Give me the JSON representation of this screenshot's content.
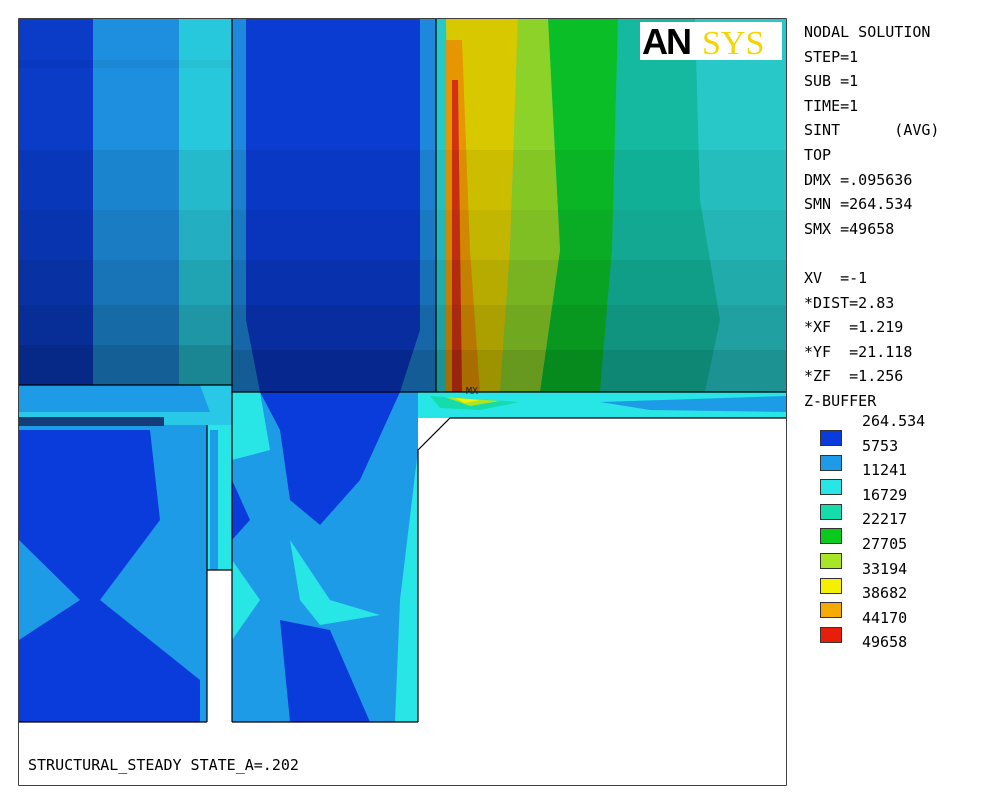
{
  "logo": {
    "part1": "AN",
    "part2": "SYS",
    "color1": "#000000",
    "color2": "#f5d400"
  },
  "info_lines": [
    "NODAL SOLUTION",
    "STEP=1",
    "SUB =1",
    "TIME=1",
    "SINT      (AVG)",
    "TOP",
    "DMX =.095636",
    "SMN =264.534",
    "SMX =49658",
    "",
    "XV  =-1",
    "*DIST=2.83",
    "*XF  =1.219",
    "*YF  =21.118",
    "*ZF  =1.256",
    "Z-BUFFER"
  ],
  "legend": {
    "values": [
      "264.534",
      "5753",
      "11241",
      "16729",
      "22217",
      "27705",
      "33194",
      "38682",
      "44170",
      "49658"
    ],
    "colors": [
      "#0a3cdc",
      "#1e9be6",
      "#28e6e6",
      "#14dcaa",
      "#0aca1e",
      "#aae628",
      "#f5f000",
      "#f5aa00",
      "#e61e0a"
    ]
  },
  "max_marker": "MX",
  "caption": "STRUCTURAL_STEADY STATE_A=.202"
}
